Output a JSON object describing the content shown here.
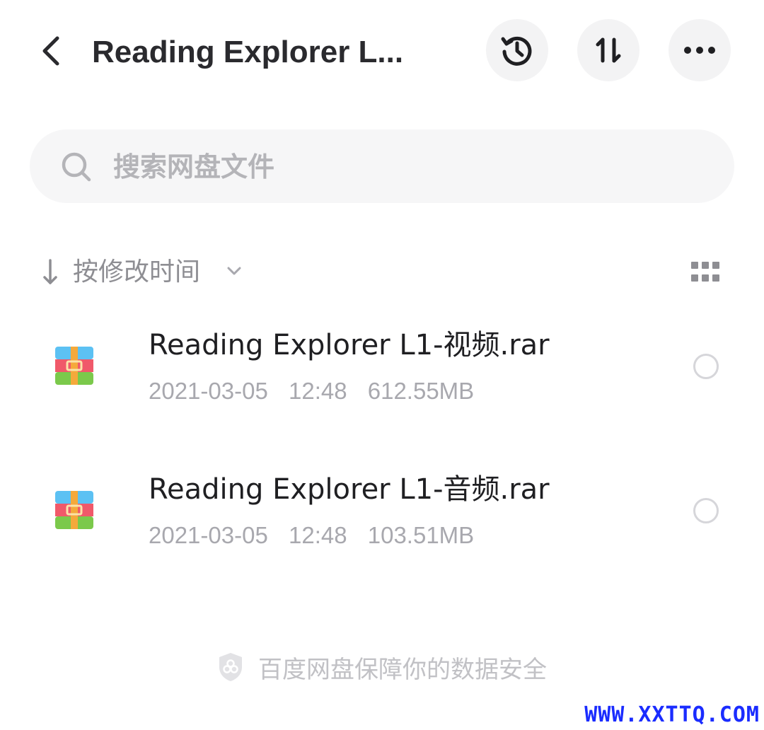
{
  "header": {
    "title": "Reading Explorer L...",
    "back_icon": "chevron-left-icon",
    "actions": [
      {
        "name": "history",
        "icon": "history-clock-icon"
      },
      {
        "name": "transfer",
        "icon": "up-down-arrows-icon"
      },
      {
        "name": "more",
        "icon": "more-dots-icon"
      }
    ]
  },
  "search": {
    "placeholder": "搜索网盘文件",
    "value": ""
  },
  "sort": {
    "label": "按修改时间",
    "direction_icon": "arrow-down-icon",
    "view_icon": "grid-view-icon"
  },
  "files": [
    {
      "name": "Reading Explorer L1-视频.rar",
      "date": "2021-03-05",
      "time": "12:48",
      "size": "612.55MB",
      "icon": "rar-archive-icon",
      "selected": false
    },
    {
      "name": "Reading Explorer L1-音频.rar",
      "date": "2021-03-05",
      "time": "12:48",
      "size": "103.51MB",
      "icon": "rar-archive-icon",
      "selected": false
    }
  ],
  "footer": {
    "text": "百度网盘保障你的数据安全"
  },
  "watermark": {
    "text": "WWW.XXTTQ.COM"
  },
  "colors": {
    "background": "#ffffff",
    "button_bg": "#f3f3f4",
    "search_bg": "#f6f6f7",
    "muted_text": "#a8a8ae",
    "watermark": "#1a2cff"
  }
}
